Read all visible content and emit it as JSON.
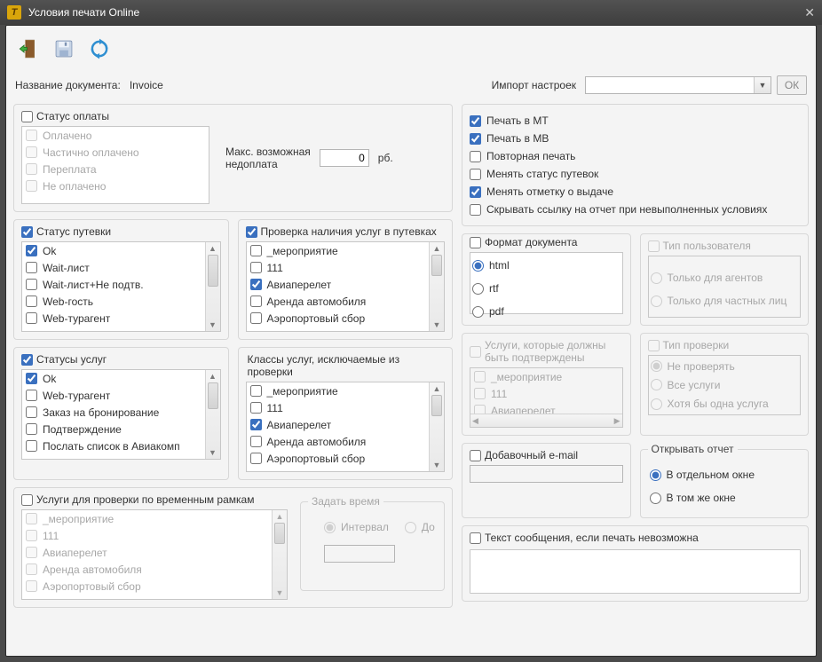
{
  "window": {
    "title": "Условия печати Online"
  },
  "header": {
    "doc_label": "Название документа:",
    "doc_value": "Invoice",
    "import_label": "Импорт настроек",
    "ok": "ОК"
  },
  "payment": {
    "title": "Статус оплаты",
    "items": [
      "Оплачено",
      "Частично оплачено",
      "Переплата",
      "Не оплачено"
    ],
    "max_label1": "Макс. возможная",
    "max_label2": "недоплата",
    "max_value": "0",
    "currency": "рб."
  },
  "voucher": {
    "title": "Статус путевки",
    "items": [
      {
        "label": "Ok",
        "checked": true
      },
      {
        "label": "Wait-лист",
        "checked": false
      },
      {
        "label": "Wait-лист+Не подтв.",
        "checked": false
      },
      {
        "label": "Web-гость",
        "checked": false
      },
      {
        "label": "Web-турагент",
        "checked": false
      }
    ]
  },
  "servcheck": {
    "title": "Проверка наличия услуг в путевках",
    "items": [
      {
        "label": "_мероприятие",
        "checked": false
      },
      {
        "label": "111",
        "checked": false
      },
      {
        "label": "Авиаперелет",
        "checked": true
      },
      {
        "label": "Аренда автомобиля",
        "checked": false
      },
      {
        "label": "Аэропортовый сбор",
        "checked": false
      }
    ]
  },
  "svcstatus": {
    "title": "Статусы услуг",
    "items": [
      {
        "label": "Ok",
        "checked": true
      },
      {
        "label": "Web-турагент",
        "checked": false
      },
      {
        "label": "Заказ на бронирование",
        "checked": false
      },
      {
        "label": "Подтверждение",
        "checked": false
      },
      {
        "label": "Послать список в Авиакомп",
        "checked": false
      }
    ]
  },
  "svcclasses": {
    "title": "Классы услуг, исключаемые из проверки",
    "items": [
      {
        "label": "_мероприятие",
        "checked": false
      },
      {
        "label": "111",
        "checked": false
      },
      {
        "label": "Авиаперелет",
        "checked": true
      },
      {
        "label": "Аренда автомобиля",
        "checked": false
      },
      {
        "label": "Аэропортовый сбор",
        "checked": false
      }
    ]
  },
  "timesvc": {
    "title": "Услуги для проверки по временным рамкам",
    "items": [
      "_мероприятие",
      "111",
      "Авиаперелет",
      "Аренда автомобиля",
      "Аэропортовый сбор"
    ],
    "time_legend": "Задать время",
    "opt_interval": "Интервал",
    "opt_until": "До"
  },
  "flags": {
    "items": [
      {
        "label": "Печать в МТ",
        "checked": true
      },
      {
        "label": "Печать в МВ",
        "checked": true
      },
      {
        "label": "Повторная печать",
        "checked": false
      },
      {
        "label": "Менять статус путевок",
        "checked": false
      },
      {
        "label": "Менять отметку о выдаче",
        "checked": true
      },
      {
        "label": "Скрывать ссылку на отчет при невыполненных условиях",
        "checked": false
      }
    ]
  },
  "format": {
    "legend": "Формат документа",
    "opts": [
      "html",
      "rtf",
      "pdf"
    ],
    "selected": "html"
  },
  "usertype": {
    "title": "Тип пользователя",
    "opts": [
      "Только для агентов",
      "Только для частных лиц"
    ]
  },
  "mustconfirm": {
    "title": "Услуги, которые должны быть подтверждены",
    "items": [
      "_мероприятие",
      "111",
      "Авиаперелет"
    ]
  },
  "checktype": {
    "title": "Тип проверки",
    "opts": [
      "Не проверять",
      "Все услуги",
      "Хотя бы одна услуга"
    ]
  },
  "extraemail": {
    "title": "Добавочный e-mail"
  },
  "openreport": {
    "legend": "Открывать отчет",
    "opts": [
      "В отдельном окне",
      "В том же окне"
    ],
    "selected": "В отдельном окне"
  },
  "msg": {
    "title": "Текст сообщения, если печать невозможна"
  }
}
